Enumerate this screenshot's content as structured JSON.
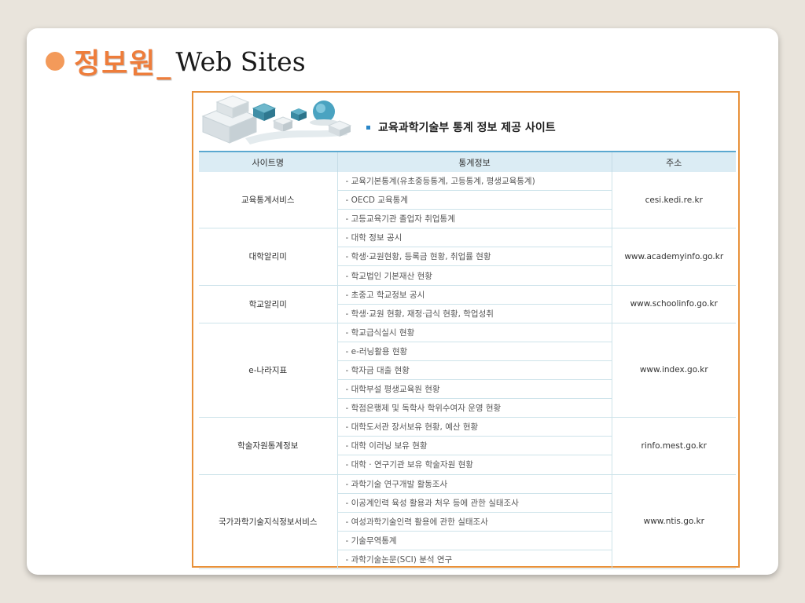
{
  "slide": {
    "title_korean": "정보원_",
    "title_english": "Web Sites"
  },
  "banner": {
    "title": "교육과학기술부 통계 정보 제공 사이트"
  },
  "table": {
    "headers": [
      "사이트명",
      "통계정보",
      "주소"
    ],
    "groups": [
      {
        "site": "교육통계서비스",
        "address": "cesi.kedi.re.kr",
        "details": [
          "- 교육기본통계(유초중등통계, 고등통계, 평생교육통계)",
          "- OECD 교육통계",
          "- 고등교육기관 졸업자 취업통계"
        ]
      },
      {
        "site": "대학알리미",
        "address": "www.academyinfo.go.kr",
        "details": [
          "- 대학 정보 공시",
          "- 학생·교원현황, 등록금 현황, 취업률 현황",
          "- 학교법인 기본재산 현황"
        ]
      },
      {
        "site": "학교알리미",
        "address": "www.schoolinfo.go.kr",
        "details": [
          "- 초중고 학교정보 공시",
          "- 학생·교원 현황, 재정·급식 현황, 학업성취"
        ]
      },
      {
        "site": "e-나라지표",
        "address": "www.index.go.kr",
        "details": [
          "- 학교급식실시 현황",
          "- e-러닝활용 현황",
          "- 학자금 대출 현황",
          "- 대학부설 평생교육원 현황",
          "- 학점은행제 및 독학사 학위수여자 운영 현황"
        ]
      },
      {
        "site": "학술자원통계정보",
        "address": "rinfo.mest.go.kr",
        "details": [
          "- 대학도서관 장서보유 현황, 예산 현황",
          "- 대학 이러닝 보유 현황",
          "- 대학 · 연구기관 보유 학술자원 현황"
        ]
      },
      {
        "site": "국가과학기술지식정보서비스",
        "address": "www.ntis.go.kr",
        "details": [
          "- 과학기술 연구개발 활동조사",
          "- 이공계인력 육성 활용과 처우 등에 관한 실태조사",
          "- 여성과학기술인력 활용에 관한 실태조사",
          "- 기술무역통계",
          "- 과학기술논문(SCI) 분석 연구"
        ]
      }
    ]
  },
  "colors": {
    "title_orange": "#ee7d3b",
    "frame_border": "#e8913a",
    "header_bg": "#dbecf4",
    "header_line": "#5aa8d0"
  },
  "icons": {
    "bullet": "orange-circle-bullet",
    "banner_graphic": "cubes-globe-graphic"
  }
}
